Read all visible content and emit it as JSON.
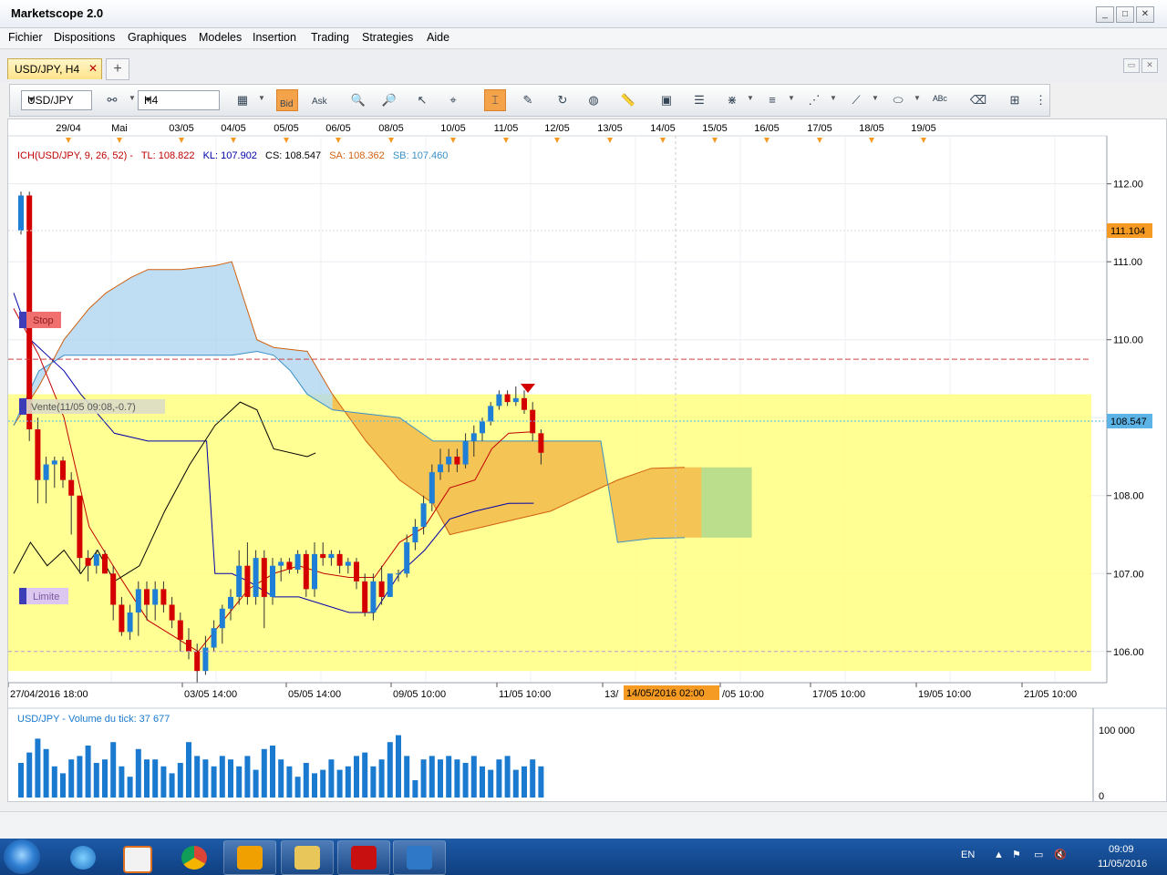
{
  "window": {
    "title": "Marketscope 2.0",
    "buttons": [
      "_",
      "□",
      "✕"
    ]
  },
  "menu": [
    "Fichier",
    "Dispositions",
    "Graphiques",
    "Modeles",
    "Insertion",
    "Trading",
    "Strategies",
    "Aide"
  ],
  "tabs": [
    {
      "label": "USD/JPY, H4",
      "close": "✕"
    }
  ],
  "new_tab": "+",
  "toolbar": {
    "instrument": "USD/JPY",
    "timeframe": "H4",
    "bid_label": "Bid",
    "ask_label": "Ask"
  },
  "colors": {
    "accent": "#f5a34b",
    "bull": "#1f7fd6",
    "bear": "#d40000",
    "band": "#ffff80",
    "tag_orange": "#f59a23",
    "price_tag": "#5bb3e6"
  },
  "chart": {
    "indicator_prefix": "ICH(USD/JPY, 9, 26, 52) -",
    "tl": "TL: 108.822",
    "kl": "KL: 107.902",
    "cs": "CS: 108.547",
    "sa": "SA: 108.362",
    "sb": "SB: 107.460",
    "stop_label": "Stop",
    "limit_label": "Limite",
    "order_label": "Vente(11/05 09:08,-0.7)",
    "price_tag_level": "111.104",
    "current_price": "108.547",
    "cursor_date": "14/05/2016 02:00",
    "top_dates": [
      "29/04",
      "Mai",
      "03/05",
      "04/05",
      "05/05",
      "06/05",
      "08/05",
      "10/05",
      "11/05",
      "12/05",
      "13/05",
      "14/05",
      "15/05",
      "16/05",
      "17/05",
      "18/05",
      "19/05"
    ],
    "bottom_dates": [
      "27/04/2016 18:00",
      "03/05 14:00",
      "05/05 14:00",
      "09/05 10:00",
      "11/05 10:00",
      "13/",
      "/05 10:00",
      "17/05 10:00",
      "19/05 10:00",
      "21/05 10:00"
    ],
    "y_labels": [
      "112.00",
      "111.00",
      "110.00",
      "109.00",
      "108.00",
      "107.00",
      "106.00"
    ],
    "volume_label": "USD/JPY - Volume du tick: 37 677",
    "volume_ticks": [
      "100 000",
      "0"
    ]
  },
  "chart_data": {
    "type": "candlestick",
    "timeframe": "H4",
    "instrument": "USD/JPY",
    "ylim": [
      105.6,
      112.3
    ],
    "candles": [
      {
        "o": 111.4,
        "h": 111.9,
        "l": 111.35,
        "c": 111.85
      },
      {
        "o": 111.85,
        "h": 111.9,
        "l": 108.7,
        "c": 108.85
      },
      {
        "o": 108.85,
        "h": 109.0,
        "l": 107.9,
        "c": 108.2
      },
      {
        "o": 108.2,
        "h": 108.5,
        "l": 107.9,
        "c": 108.4
      },
      {
        "o": 108.4,
        "h": 108.5,
        "l": 108.1,
        "c": 108.45
      },
      {
        "o": 108.45,
        "h": 108.5,
        "l": 108.1,
        "c": 108.2
      },
      {
        "o": 108.2,
        "h": 108.3,
        "l": 107.5,
        "c": 108.0
      },
      {
        "o": 108.0,
        "h": 108.0,
        "l": 107.0,
        "c": 107.2
      },
      {
        "o": 107.2,
        "h": 107.3,
        "l": 106.9,
        "c": 107.1
      },
      {
        "o": 107.1,
        "h": 107.3,
        "l": 107.0,
        "c": 107.25
      },
      {
        "o": 107.25,
        "h": 107.3,
        "l": 107.0,
        "c": 107.0
      },
      {
        "o": 107.0,
        "h": 107.1,
        "l": 106.4,
        "c": 106.6
      },
      {
        "o": 106.6,
        "h": 106.7,
        "l": 106.2,
        "c": 106.25
      },
      {
        "o": 106.25,
        "h": 106.6,
        "l": 106.15,
        "c": 106.5
      },
      {
        "o": 106.5,
        "h": 106.9,
        "l": 106.2,
        "c": 106.8
      },
      {
        "o": 106.8,
        "h": 106.9,
        "l": 106.4,
        "c": 106.6
      },
      {
        "o": 106.6,
        "h": 106.9,
        "l": 106.4,
        "c": 106.8
      },
      {
        "o": 106.8,
        "h": 106.9,
        "l": 106.5,
        "c": 106.6
      },
      {
        "o": 106.6,
        "h": 106.7,
        "l": 106.3,
        "c": 106.4
      },
      {
        "o": 106.4,
        "h": 106.5,
        "l": 106.0,
        "c": 106.15
      },
      {
        "o": 106.15,
        "h": 106.3,
        "l": 105.9,
        "c": 106.0
      },
      {
        "o": 106.0,
        "h": 106.1,
        "l": 105.6,
        "c": 105.75
      },
      {
        "o": 105.75,
        "h": 106.2,
        "l": 105.7,
        "c": 106.05
      },
      {
        "o": 106.05,
        "h": 106.4,
        "l": 106.0,
        "c": 106.3
      },
      {
        "o": 106.3,
        "h": 106.6,
        "l": 106.1,
        "c": 106.55
      },
      {
        "o": 106.55,
        "h": 106.8,
        "l": 106.4,
        "c": 106.7
      },
      {
        "o": 106.7,
        "h": 107.3,
        "l": 106.6,
        "c": 107.1
      },
      {
        "o": 107.1,
        "h": 107.4,
        "l": 106.6,
        "c": 106.7
      },
      {
        "o": 106.7,
        "h": 107.3,
        "l": 106.6,
        "c": 107.2
      },
      {
        "o": 107.2,
        "h": 107.3,
        "l": 106.3,
        "c": 106.7
      },
      {
        "o": 106.7,
        "h": 107.2,
        "l": 106.6,
        "c": 107.1
      },
      {
        "o": 107.1,
        "h": 107.2,
        "l": 106.9,
        "c": 107.15
      },
      {
        "o": 107.15,
        "h": 107.2,
        "l": 107.0,
        "c": 107.05
      },
      {
        "o": 107.05,
        "h": 107.3,
        "l": 107.0,
        "c": 107.25
      },
      {
        "o": 107.25,
        "h": 107.3,
        "l": 106.7,
        "c": 106.8
      },
      {
        "o": 106.8,
        "h": 107.4,
        "l": 106.7,
        "c": 107.25
      },
      {
        "o": 107.25,
        "h": 107.4,
        "l": 107.1,
        "c": 107.2
      },
      {
        "o": 107.2,
        "h": 107.3,
        "l": 107.1,
        "c": 107.25
      },
      {
        "o": 107.25,
        "h": 107.3,
        "l": 107.0,
        "c": 107.1
      },
      {
        "o": 107.1,
        "h": 107.2,
        "l": 107.0,
        "c": 107.15
      },
      {
        "o": 107.15,
        "h": 107.2,
        "l": 106.8,
        "c": 106.9
      },
      {
        "o": 106.9,
        "h": 107.0,
        "l": 106.45,
        "c": 106.5
      },
      {
        "o": 106.5,
        "h": 107.0,
        "l": 106.4,
        "c": 106.9
      },
      {
        "o": 106.9,
        "h": 107.1,
        "l": 106.6,
        "c": 106.7
      },
      {
        "o": 106.7,
        "h": 107.0,
        "l": 106.7,
        "c": 107.0
      },
      {
        "o": 107.0,
        "h": 107.05,
        "l": 106.9,
        "c": 107.0
      },
      {
        "o": 107.0,
        "h": 107.5,
        "l": 106.95,
        "c": 107.4
      },
      {
        "o": 107.4,
        "h": 107.7,
        "l": 107.3,
        "c": 107.6
      },
      {
        "o": 107.6,
        "h": 108.0,
        "l": 107.5,
        "c": 107.9
      },
      {
        "o": 107.9,
        "h": 108.4,
        "l": 107.8,
        "c": 108.3
      },
      {
        "o": 108.3,
        "h": 108.6,
        "l": 108.2,
        "c": 108.4
      },
      {
        "o": 108.4,
        "h": 108.6,
        "l": 108.3,
        "c": 108.5
      },
      {
        "o": 108.5,
        "h": 108.6,
        "l": 108.3,
        "c": 108.4
      },
      {
        "o": 108.4,
        "h": 108.8,
        "l": 108.35,
        "c": 108.7
      },
      {
        "o": 108.7,
        "h": 108.9,
        "l": 108.5,
        "c": 108.8
      },
      {
        "o": 108.8,
        "h": 109.0,
        "l": 108.7,
        "c": 108.95
      },
      {
        "o": 108.95,
        "h": 109.2,
        "l": 108.9,
        "c": 109.15
      },
      {
        "o": 109.15,
        "h": 109.35,
        "l": 109.1,
        "c": 109.3
      },
      {
        "o": 109.3,
        "h": 109.35,
        "l": 109.15,
        "c": 109.2
      },
      {
        "o": 109.2,
        "h": 109.4,
        "l": 109.15,
        "c": 109.25
      },
      {
        "o": 109.25,
        "h": 109.35,
        "l": 109.05,
        "c": 109.1
      },
      {
        "o": 109.1,
        "h": 109.2,
        "l": 108.7,
        "c": 108.8
      },
      {
        "o": 108.8,
        "h": 108.85,
        "l": 108.4,
        "c": 108.55
      }
    ],
    "tenkan": [
      [
        0,
        110.4
      ],
      [
        3,
        109.8
      ],
      [
        6,
        109.0
      ],
      [
        9,
        107.6
      ],
      [
        13,
        106.9
      ],
      [
        16,
        106.4
      ],
      [
        19,
        106.2
      ],
      [
        22,
        106.0
      ],
      [
        25,
        106.4
      ],
      [
        28,
        106.8
      ],
      [
        31,
        107.0
      ],
      [
        34,
        107.1
      ],
      [
        37,
        107.0
      ],
      [
        40,
        106.95
      ],
      [
        43,
        106.95
      ],
      [
        46,
        107.4
      ],
      [
        49,
        107.6
      ],
      [
        52,
        108.1
      ],
      [
        55,
        108.2
      ],
      [
        57,
        108.6
      ],
      [
        59,
        108.8
      ],
      [
        62,
        108.82
      ]
    ],
    "kijun": [
      [
        0,
        110.6
      ],
      [
        2,
        110.0
      ],
      [
        4,
        109.8
      ],
      [
        6,
        109.6
      ],
      [
        8,
        109.3
      ],
      [
        12,
        108.8
      ],
      [
        16,
        108.7
      ],
      [
        21,
        108.7
      ],
      [
        23,
        108.7
      ],
      [
        24,
        107.0
      ],
      [
        26,
        107.0
      ],
      [
        28,
        106.9
      ],
      [
        31,
        106.7
      ],
      [
        34,
        106.7
      ],
      [
        37,
        106.6
      ],
      [
        40,
        106.5
      ],
      [
        43,
        106.5
      ],
      [
        46,
        107.0
      ],
      [
        49,
        107.3
      ],
      [
        52,
        107.7
      ],
      [
        55,
        107.8
      ],
      [
        59,
        107.9
      ],
      [
        62,
        107.902
      ]
    ],
    "chikou": [
      [
        0,
        107.0
      ],
      [
        2,
        107.4
      ],
      [
        4,
        107.1
      ],
      [
        6,
        107.3
      ],
      [
        8,
        107.0
      ],
      [
        10,
        107.3
      ],
      [
        12,
        106.9
      ],
      [
        15,
        107.1
      ],
      [
        18,
        107.8
      ],
      [
        21,
        108.4
      ],
      [
        24,
        108.9
      ],
      [
        27,
        109.2
      ],
      [
        29,
        109.1
      ],
      [
        31,
        108.6
      ],
      [
        35,
        108.5
      ],
      [
        36,
        108.547
      ]
    ],
    "senkou_a": [
      [
        0,
        108.9
      ],
      [
        3,
        109.4
      ],
      [
        6,
        110.0
      ],
      [
        9,
        110.4
      ],
      [
        11,
        110.6
      ],
      [
        14,
        110.8
      ],
      [
        16,
        110.9
      ],
      [
        20,
        110.9
      ],
      [
        24,
        110.95
      ],
      [
        26,
        111.0
      ],
      [
        29,
        110.0
      ],
      [
        31,
        109.9
      ],
      [
        35,
        109.85
      ],
      [
        38,
        109.3
      ],
      [
        42,
        108.7
      ],
      [
        46,
        108.2
      ],
      [
        50,
        107.9
      ],
      [
        52,
        107.5
      ],
      [
        56,
        107.6
      ],
      [
        60,
        107.7
      ],
      [
        64,
        107.8
      ],
      [
        68,
        108.0
      ],
      [
        72,
        108.2
      ],
      [
        76,
        108.35
      ],
      [
        80,
        108.362
      ]
    ],
    "senkou_b": [
      [
        0,
        108.9
      ],
      [
        3,
        109.6
      ],
      [
        6,
        109.8
      ],
      [
        10,
        109.8
      ],
      [
        14,
        109.8
      ],
      [
        18,
        109.8
      ],
      [
        22,
        109.8
      ],
      [
        26,
        109.8
      ],
      [
        29,
        109.85
      ],
      [
        31,
        109.8
      ],
      [
        33,
        109.6
      ],
      [
        35,
        109.3
      ],
      [
        38,
        109.1
      ],
      [
        42,
        109.05
      ],
      [
        46,
        109.0
      ],
      [
        50,
        108.7
      ],
      [
        54,
        108.7
      ],
      [
        58,
        108.7
      ],
      [
        62,
        108.7
      ],
      [
        66,
        108.7
      ],
      [
        70,
        108.7
      ],
      [
        72,
        107.4
      ],
      [
        76,
        107.45
      ],
      [
        80,
        107.46
      ]
    ],
    "stop_level": 109.75,
    "limit_level": 106.0,
    "band": [
      105.75,
      109.3
    ],
    "volume": [
      50,
      65,
      85,
      70,
      45,
      35,
      55,
      60,
      75,
      50,
      55,
      80,
      45,
      30,
      70,
      55,
      55,
      45,
      35,
      50,
      80,
      60,
      55,
      45,
      60,
      55,
      45,
      60,
      40,
      70,
      75,
      55,
      45,
      30,
      50,
      35,
      40,
      55,
      40,
      45,
      60,
      65,
      45,
      55,
      80,
      90,
      60,
      25,
      55,
      60,
      55,
      60,
      55,
      50,
      60,
      45,
      40,
      55,
      60,
      40,
      45,
      55,
      45
    ]
  }
}
